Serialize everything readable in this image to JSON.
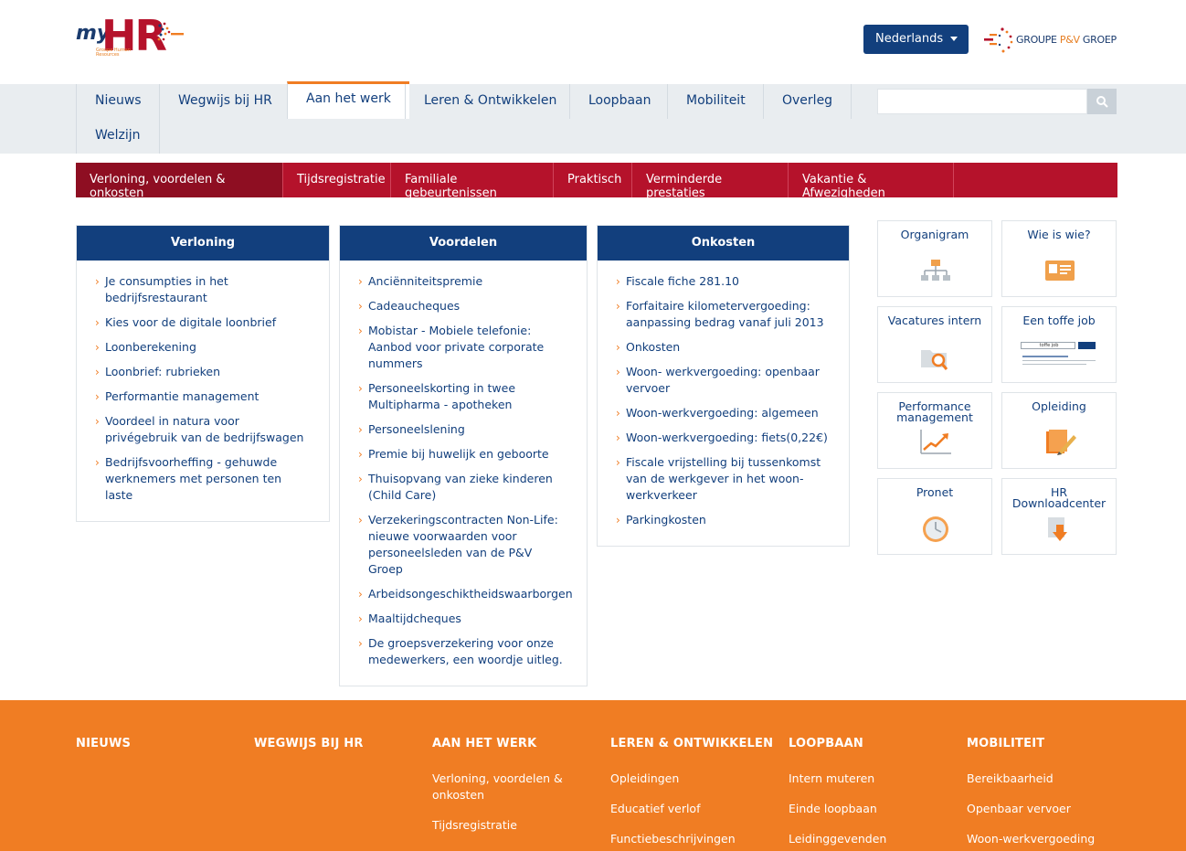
{
  "header": {
    "logo_my": "my",
    "logo_hr": "HR",
    "logo_sub": "Groupe Human Resources",
    "language": "Nederlands",
    "partner_logo_a": "GROUPE",
    "partner_logo_b": "P&V",
    "partner_logo_c": "GROEP"
  },
  "main_nav": {
    "items": [
      {
        "label": "Nieuws"
      },
      {
        "label": "Wegwijs bij HR"
      },
      {
        "label": "Aan het werk"
      },
      {
        "label": "Leren & Ontwikkelen"
      },
      {
        "label": "Loopbaan"
      },
      {
        "label": "Mobiliteit"
      },
      {
        "label": "Overleg"
      },
      {
        "label": "Welzijn"
      }
    ],
    "active": "Aan het werk",
    "search_value": ""
  },
  "sub_nav": {
    "items": [
      {
        "label": "Verloning, voordelen & onkosten"
      },
      {
        "label": "Tijdsregistratie"
      },
      {
        "label": "Familiale gebeurtenissen"
      },
      {
        "label": "Praktisch"
      },
      {
        "label": "Verminderde prestaties"
      },
      {
        "label": "Vakantie & Afwezigheden"
      }
    ],
    "active": "Verloning, voordelen & onkosten"
  },
  "columns": [
    {
      "title": "Verloning",
      "links": [
        "Je consumpties in het bedrijfsrestaurant",
        "Kies voor de digitale loonbrief",
        "Loonberekening",
        "Loonbrief: rubrieken",
        "Performantie management",
        "Voordeel in natura voor privégebruik van de bedrijfswagen",
        "Bedrijfsvoorheffing - gehuwde werknemers met personen ten laste"
      ]
    },
    {
      "title": "Voordelen",
      "links": [
        "Anciënniteitspremie",
        "Cadeaucheques",
        "Mobistar - Mobiele telefonie: Aanbod voor private corporate nummers",
        "Personeelskorting in twee Multipharma - apotheken",
        "Personeelslening",
        "Premie bij huwelijk en geboorte",
        "Thuisopvang van zieke kinderen (Child Care)",
        "Verzekeringscontracten Non-Life: nieuwe voorwaarden voor personeelsleden van de P&V Groep",
        "Arbeidsongeschiktheidswaarborgen",
        "Maaltijdcheques",
        "De groepsverzekering voor onze medewerkers, een woordje uitleg."
      ]
    },
    {
      "title": "Onkosten",
      "links": [
        "Fiscale fiche 281.10",
        "Forfaitaire kilometervergoeding: aanpassing bedrag vanaf juli 2013",
        "Onkosten",
        "Woon- werkvergoeding: openbaar vervoer",
        "Woon-werkvergoeding: algemeen",
        "Woon-werkvergoeding: fiets(0,22€)",
        "Fiscale vrijstelling bij tussenkomst van de werkgever in het woon-werkverkeer",
        "Parkingkosten"
      ]
    }
  ],
  "tiles": [
    {
      "label": "Organigram",
      "icon": "organigram-icon"
    },
    {
      "label": "Wie is wie?",
      "icon": "id-card-icon"
    },
    {
      "label": "Vacatures intern",
      "icon": "folder-search-icon"
    },
    {
      "label": "Een toffe job",
      "icon": "search-screenshot-icon"
    },
    {
      "label": "Performance management",
      "icon": "chart-trend-icon"
    },
    {
      "label": "Opleiding",
      "icon": "pencil-paper-icon"
    },
    {
      "label": "Pronet",
      "icon": "clock-icon"
    },
    {
      "label": "HR Downloadcenter",
      "icon": "download-icon"
    }
  ],
  "tile_mini_search": "toffe job",
  "footer": {
    "columns": [
      {
        "title": "NIEUWS",
        "links": []
      },
      {
        "title": "WEGWIJS BIJ HR",
        "links": []
      },
      {
        "title": "AAN HET WERK",
        "links": [
          "Verloning, voordelen & onkosten",
          "Tijdsregistratie"
        ]
      },
      {
        "title": "LEREN & ONTWIKKELEN",
        "links": [
          "Opleidingen",
          "Educatief verlof",
          "Functiebeschrijvingen"
        ]
      },
      {
        "title": "LOOPBAAN",
        "links": [
          "Intern muteren",
          "Einde loopbaan",
          "Leidinggevenden"
        ]
      },
      {
        "title": "MOBILITEIT",
        "links": [
          "Bereikbaarheid",
          "Openbaar vervoer",
          "Woon-werkvergoeding"
        ]
      }
    ]
  },
  "colors": {
    "navy": "#123f7d",
    "crimson": "#b5122b",
    "orange": "#f07d23",
    "nav_bg": "#e9edf0"
  }
}
